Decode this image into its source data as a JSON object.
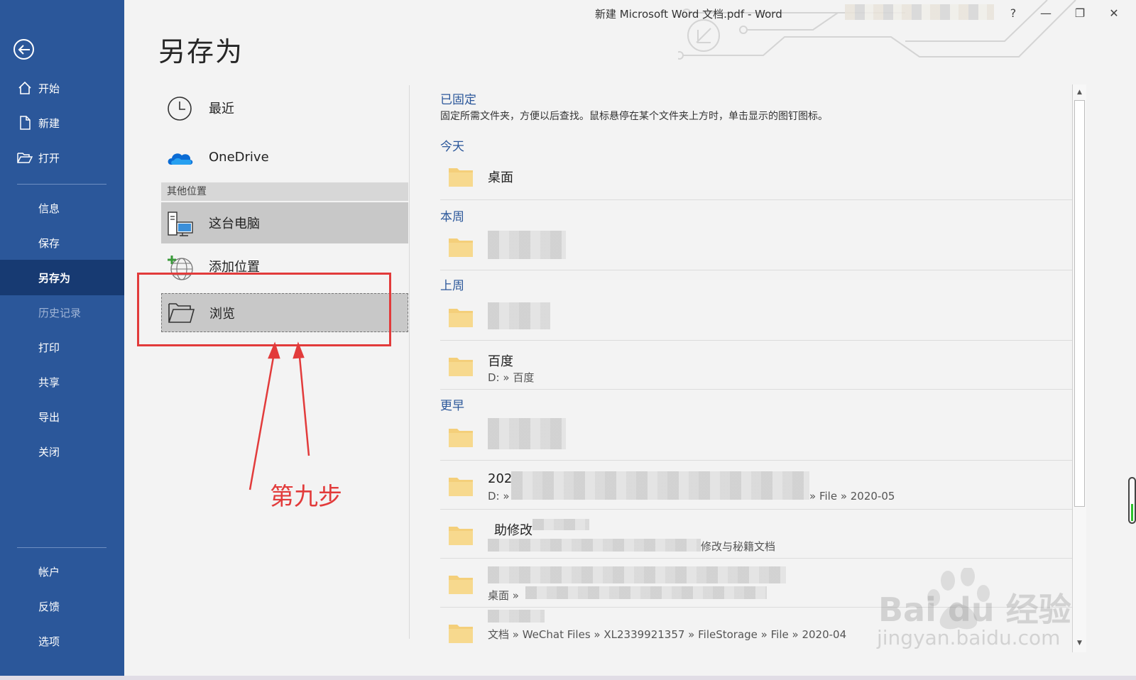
{
  "window": {
    "title": "新建 Microsoft Word 文档.pdf  -  Word",
    "help_label": "?",
    "minimize_label": "—",
    "restore_label": "❐",
    "close_label": "✕"
  },
  "sidebar": {
    "items": [
      {
        "label": "开始",
        "icon": "home-icon"
      },
      {
        "label": "新建",
        "icon": "new-document-icon"
      },
      {
        "label": "打开",
        "icon": "open-folder-icon"
      },
      {
        "label": "信息"
      },
      {
        "label": "保存"
      },
      {
        "label": "另存为",
        "active": true
      },
      {
        "label": "历史记录",
        "disabled": true
      },
      {
        "label": "打印"
      },
      {
        "label": "共享"
      },
      {
        "label": "导出"
      },
      {
        "label": "关闭"
      },
      {
        "label": "帐户"
      },
      {
        "label": "反馈"
      },
      {
        "label": "选项"
      }
    ]
  },
  "page": {
    "title": "另存为"
  },
  "locations": {
    "recent": "最近",
    "onedrive": "OneDrive",
    "other_header": "其他位置",
    "this_pc": "这台电脑",
    "add_location": "添加位置",
    "browse": "浏览"
  },
  "annotation": {
    "step_label": "第九步"
  },
  "folders": {
    "pinned_title": "已固定",
    "pinned_desc": "固定所需文件夹，方便以后查找。鼠标悬停在某个文件夹上方时，单击显示的图钉图标。",
    "today_title": "今天",
    "this_week_title": "本周",
    "last_week_title": "上周",
    "earlier_title": "更早",
    "today": [
      {
        "name": "桌面"
      }
    ],
    "last_week": [
      {
        "name": "百度",
        "path": "D: » 百度"
      }
    ],
    "earlier": [
      {
        "name": "202",
        "path": "D: »",
        "path_tail": "» File » 2020-05"
      },
      {
        "name": "助修改",
        "path_tail": "修改与秘籍文档"
      },
      {
        "path": "桌面 »"
      },
      {
        "path": "文档 » WeChat Files » XL2339921357 » FileStorage » File » 2020-04"
      }
    ]
  },
  "watermark": {
    "brand": "Bai du 经验",
    "url": "jingyan.baidu.com"
  },
  "colors": {
    "sidebar": "#2b579a",
    "sidebar_active": "#173a72",
    "accent": "#2b579a",
    "annotation": "#e23b3b",
    "folder": "#f4cf7a"
  }
}
